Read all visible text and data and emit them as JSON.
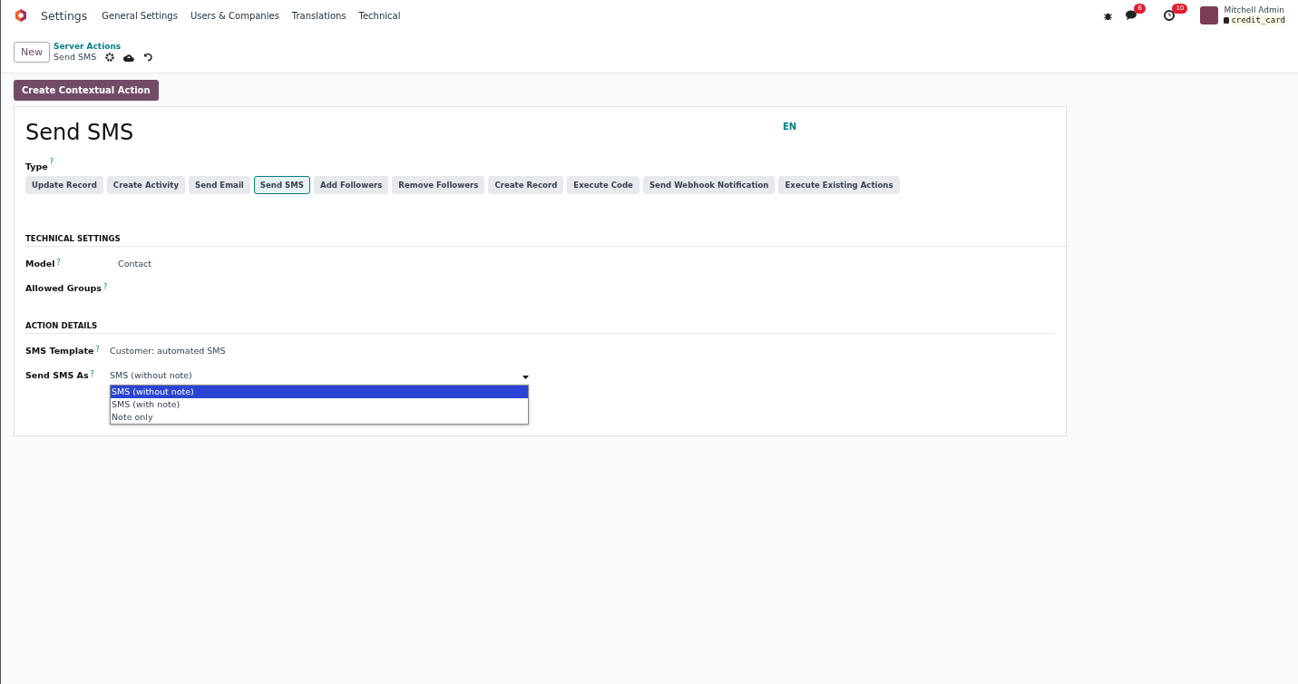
{
  "navbar": {
    "app_name": "Settings",
    "menu": [
      "General Settings",
      "Users & Companies",
      "Translations",
      "Technical"
    ],
    "messages_badge": "6",
    "activities_badge": "10",
    "user": {
      "name": "Mitchell Admin",
      "database": "credit_card"
    }
  },
  "control_panel": {
    "new_button": "New",
    "breadcrumb_parent": "Server Actions",
    "breadcrumb_current": "Send SMS"
  },
  "action_button": "Create Contextual Action",
  "form": {
    "title": "Send SMS",
    "language": "EN",
    "type_label": "Type",
    "help_mark": "?",
    "types": [
      {
        "label": "Update Record",
        "selected": false
      },
      {
        "label": "Create Activity",
        "selected": false
      },
      {
        "label": "Send Email",
        "selected": false
      },
      {
        "label": "Send SMS",
        "selected": true
      },
      {
        "label": "Add Followers",
        "selected": false
      },
      {
        "label": "Remove Followers",
        "selected": false
      },
      {
        "label": "Create Record",
        "selected": false
      },
      {
        "label": "Execute Code",
        "selected": false
      },
      {
        "label": "Send Webhook Notification",
        "selected": false
      },
      {
        "label": "Execute Existing Actions",
        "selected": false
      }
    ],
    "sections": [
      {
        "title": "TECHNICAL SETTINGS",
        "fields": [
          {
            "label": "Model",
            "value": "Contact"
          },
          {
            "label": "Allowed Groups"
          }
        ]
      },
      {
        "title": "ACTION DETAILS",
        "fields": [
          {
            "label": "SMS Template",
            "value": "Customer: automated SMS"
          },
          {
            "label": "Send SMS As",
            "kind": "select",
            "value": "SMS (without note)",
            "options": [
              {
                "label": "SMS (without note)",
                "selected": true
              },
              {
                "label": "SMS (with note)",
                "selected": false
              },
              {
                "label": "Note only",
                "selected": false
              }
            ]
          }
        ]
      }
    ]
  }
}
